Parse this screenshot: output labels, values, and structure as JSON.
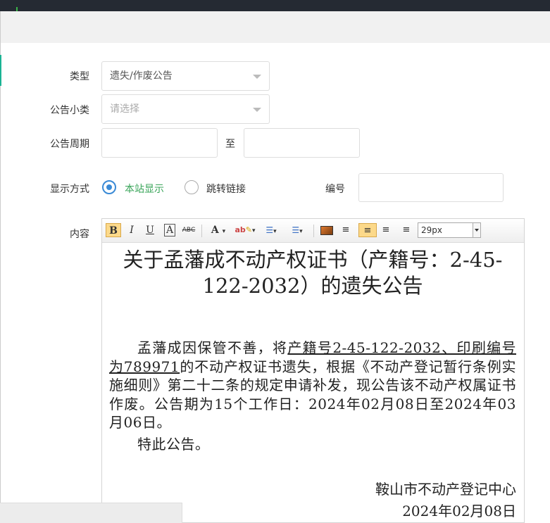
{
  "form": {
    "type_label": "类型",
    "type_value": "遗失/作废公告",
    "subcategory_label": "公告小类",
    "subcategory_placeholder": "请选择",
    "period_label": "公告周期",
    "period_to": "至",
    "display_label": "显示方式",
    "display_options": [
      "本站显示",
      "跳转链接"
    ],
    "display_selected": "本站显示",
    "number_label": "编号",
    "content_label": "内容"
  },
  "toolbar": {
    "font_size": "29px",
    "buttons": [
      "bold",
      "italic",
      "underline",
      "border-text",
      "strikethrough",
      "font-color",
      "highlight",
      "ordered-list",
      "unordered-list",
      "image",
      "align-left",
      "align-center",
      "align-right",
      "justify"
    ]
  },
  "document": {
    "title": "关于孟藩成不动产权证书（产籍号：2-45-122-2032）的遗失公告",
    "body_1_pre": "孟藩成因保管不善，将",
    "body_1_underline": "产籍号2-45-122-2032、印刷编号为789971",
    "body_1_post": "的不动产权证书遗失，根据《不动产登记暂行条例实施细则》第二十二条的规定申请补发，现公告该不动产权属证书作废。公告期为15个工作日：2024年02月08日至2024年03月06日。",
    "body_2": "特此公告。",
    "signature": "鞍山市不动产登记中心",
    "date": "2024年02月08日"
  },
  "colors": {
    "accent_green": "#3bb54a",
    "radio_blue": "#3a8ad6",
    "selected_text_green": "#3aa55a"
  }
}
